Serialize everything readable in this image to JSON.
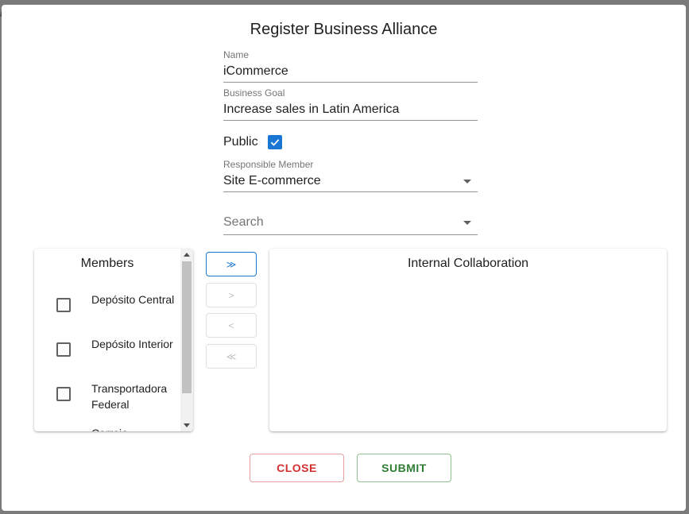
{
  "backdrop_glyph": "a",
  "dialog": {
    "title": "Register Business Alliance"
  },
  "form": {
    "name": {
      "label": "Name",
      "value": "iCommerce"
    },
    "business_goal": {
      "label": "Business Goal",
      "value": "Increase sales in Latin America"
    },
    "public": {
      "label": "Public",
      "checked": true
    },
    "responsible_member": {
      "label": "Responsible Member",
      "value": "Site E-commerce"
    },
    "search": {
      "placeholder": "Search"
    }
  },
  "members_panel": {
    "title": "Members",
    "items": [
      {
        "label": "Depósito Central",
        "checked": false
      },
      {
        "label": "Depósito Interior",
        "checked": false
      },
      {
        "label": "Transportadora Federal",
        "checked": false
      },
      {
        "label": "Correio",
        "checked": false
      }
    ]
  },
  "transfer_buttons": {
    "all_right": "≫",
    "right": ">",
    "left": "<",
    "all_left": "≪"
  },
  "collaboration_panel": {
    "title": "Internal Collaboration",
    "items": []
  },
  "actions": {
    "close_label": "CLOSE",
    "submit_label": "SUBMIT"
  },
  "colors": {
    "primary": "#1976d2",
    "close": "#d32f2f",
    "submit": "#2e7d32"
  }
}
